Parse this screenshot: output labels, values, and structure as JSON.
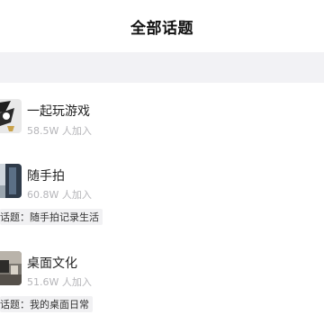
{
  "header": {
    "title": "全部话题"
  },
  "topics": [
    {
      "name": "一起玩游戏",
      "count": "58.5W 人加入",
      "tag": ""
    },
    {
      "name": "随手拍",
      "count": "60.8W 人加入",
      "tag": "话题：随手拍记录生活"
    },
    {
      "name": "桌面文化",
      "count": "51.6W 人加入",
      "tag": "话题：我的桌面日常"
    }
  ]
}
